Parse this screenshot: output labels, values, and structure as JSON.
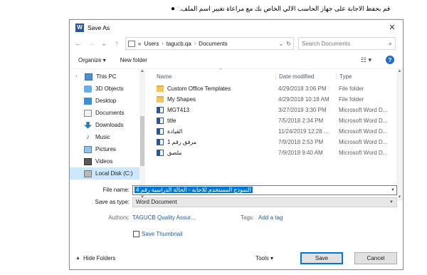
{
  "instruction": "قم بحفظ الاجابة على جهاز الحاسب الالي الخاص بك مع مراعاة تغيير اسم الملف.",
  "dialog": {
    "title": "Save As",
    "close_glyph": "✕",
    "app_icon_letter": "W"
  },
  "nav": {
    "back": "←",
    "forward": "→",
    "recent": "⌄",
    "up": "↑",
    "address": {
      "overflow": "«",
      "crumbs": [
        "Users",
        "tagucb.qa",
        "Documents"
      ],
      "dropdown": "⌄",
      "refresh": "↻"
    },
    "search_placeholder": "Search Documents"
  },
  "command_bar": {
    "organize": "Organize ▾",
    "new_folder": "New folder",
    "view": "☷ ▾",
    "help": "?"
  },
  "sidebar": {
    "items": [
      {
        "label": "This PC",
        "chev": "›",
        "icon": "pc"
      },
      {
        "label": "3D Objects",
        "chev": "›",
        "icon": "obj3d"
      },
      {
        "label": "Desktop",
        "chev": "›",
        "icon": "desk"
      },
      {
        "label": "Documents",
        "chev": "›",
        "icon": "docs"
      },
      {
        "label": "Downloads",
        "chev": "›",
        "icon": "down"
      },
      {
        "label": "Music",
        "chev": "›",
        "icon": "music"
      },
      {
        "label": "Pictures",
        "chev": "›",
        "icon": "pics"
      },
      {
        "label": "Videos",
        "chev": "›",
        "icon": "vids"
      },
      {
        "label": "Local Disk (C:)",
        "chev": "›",
        "icon": "disk"
      }
    ]
  },
  "files": {
    "headers": {
      "name": "Name",
      "date": "Date modified",
      "type": "Type"
    },
    "rows": [
      {
        "name": "Custom Office Templates",
        "date": "4/29/2018 3:06 PM",
        "type": "File folder",
        "icon": "folder"
      },
      {
        "name": "My Shapes",
        "date": "4/29/2018 10:18 AM",
        "type": "File folder",
        "icon": "folder"
      },
      {
        "name": "MGT413",
        "date": "3/27/2019 3:30 PM",
        "type": "Microsoft Word D...",
        "icon": "word"
      },
      {
        "name": "title",
        "date": "7/5/2018 2:34 PM",
        "type": "Microsoft Word D...",
        "icon": "word"
      },
      {
        "name": "القيادة",
        "date": "11/24/2019 12:28 ...",
        "type": "Microsoft Word D...",
        "icon": "word"
      },
      {
        "name": "مرفق رقم 1",
        "date": "7/9/2018 2:53 PM",
        "type": "Microsoft Word D...",
        "icon": "word"
      },
      {
        "name": "ملصق",
        "date": "7/9/2018 9:40 AM",
        "type": "Microsoft Word D...",
        "icon": "word"
      }
    ]
  },
  "form": {
    "file_name_label": "File name:",
    "file_name_value": "النموذج المستخدم للاجابة - الحالة الدراسية رقم 4",
    "save_type_label": "Save as type:",
    "save_type_value": "Word Document",
    "authors_label": "Authors:",
    "authors_value": "TAGUCB Quality Assur...",
    "tags_label": "Tags:",
    "tags_value": "Add a tag",
    "save_thumbnail": "Save Thumbnail"
  },
  "footer": {
    "hide_folders": "Hide Folders",
    "tools": "Tools ▾",
    "save": "Save",
    "cancel": "Cancel"
  }
}
